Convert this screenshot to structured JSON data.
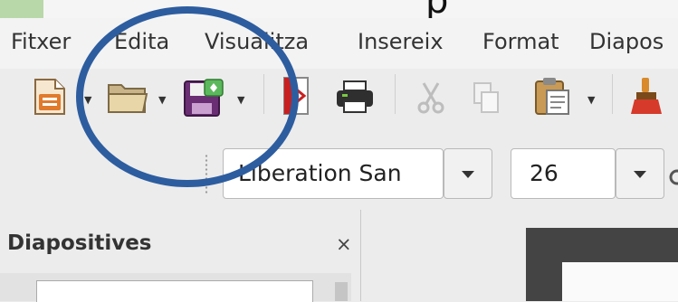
{
  "window": {
    "title_fragment": "p"
  },
  "menubar": {
    "items": [
      "Fitxer",
      "Edita",
      "Visualitza",
      "Insereix",
      "Format",
      "Diapos"
    ]
  },
  "toolbar": {
    "icons": [
      "new-document-icon",
      "open-folder-icon",
      "save-icon",
      "export-pdf-icon",
      "print-icon",
      "cut-icon",
      "copy-icon",
      "paste-icon",
      "clone-formatting-icon"
    ]
  },
  "format_bar": {
    "font_name": "Liberation San",
    "font_size": "26"
  },
  "slides_panel": {
    "title": "Diapositives",
    "close": "×"
  },
  "annotation": {
    "color": "#2d5d9f"
  }
}
